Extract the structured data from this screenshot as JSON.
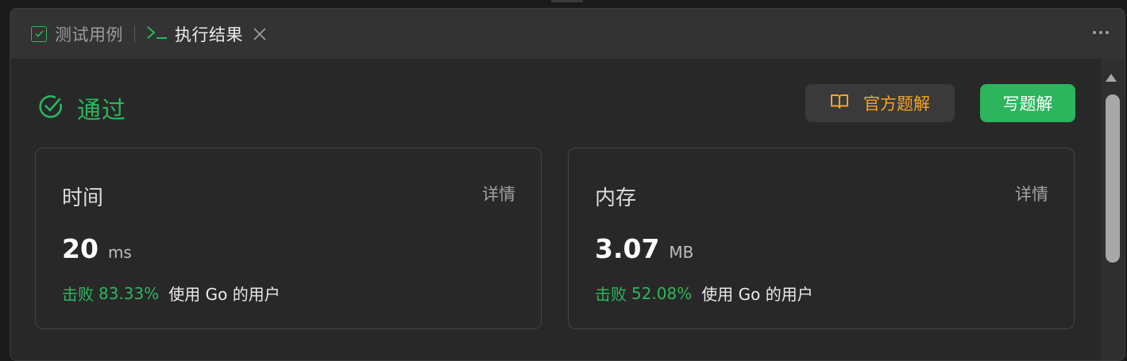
{
  "tabs": {
    "test_cases_label": "测试用例",
    "result_label": "执行结果"
  },
  "status": {
    "text": "通过",
    "color": "#2db55d"
  },
  "buttons": {
    "official_solution": "官方题解",
    "write_solution": "写题解"
  },
  "cards": {
    "time": {
      "title": "时间",
      "detail": "详情",
      "value": "20",
      "unit": "ms",
      "beat_label": "击败",
      "beat_percent": "83.33%",
      "beat_users": "使用 Go 的用户"
    },
    "memory": {
      "title": "内存",
      "detail": "详情",
      "value": "3.07",
      "unit": "MB",
      "beat_label": "击败",
      "beat_percent": "52.08%",
      "beat_users": "使用 Go 的用户"
    }
  },
  "icons": {
    "test_cases": "checkbox-icon",
    "result": "terminal-icon",
    "close": "close-icon",
    "more": "more-icon",
    "status": "check-circle-icon",
    "official": "book-icon"
  },
  "colors": {
    "accent_green": "#2db55d",
    "accent_orange": "#f5a623"
  }
}
